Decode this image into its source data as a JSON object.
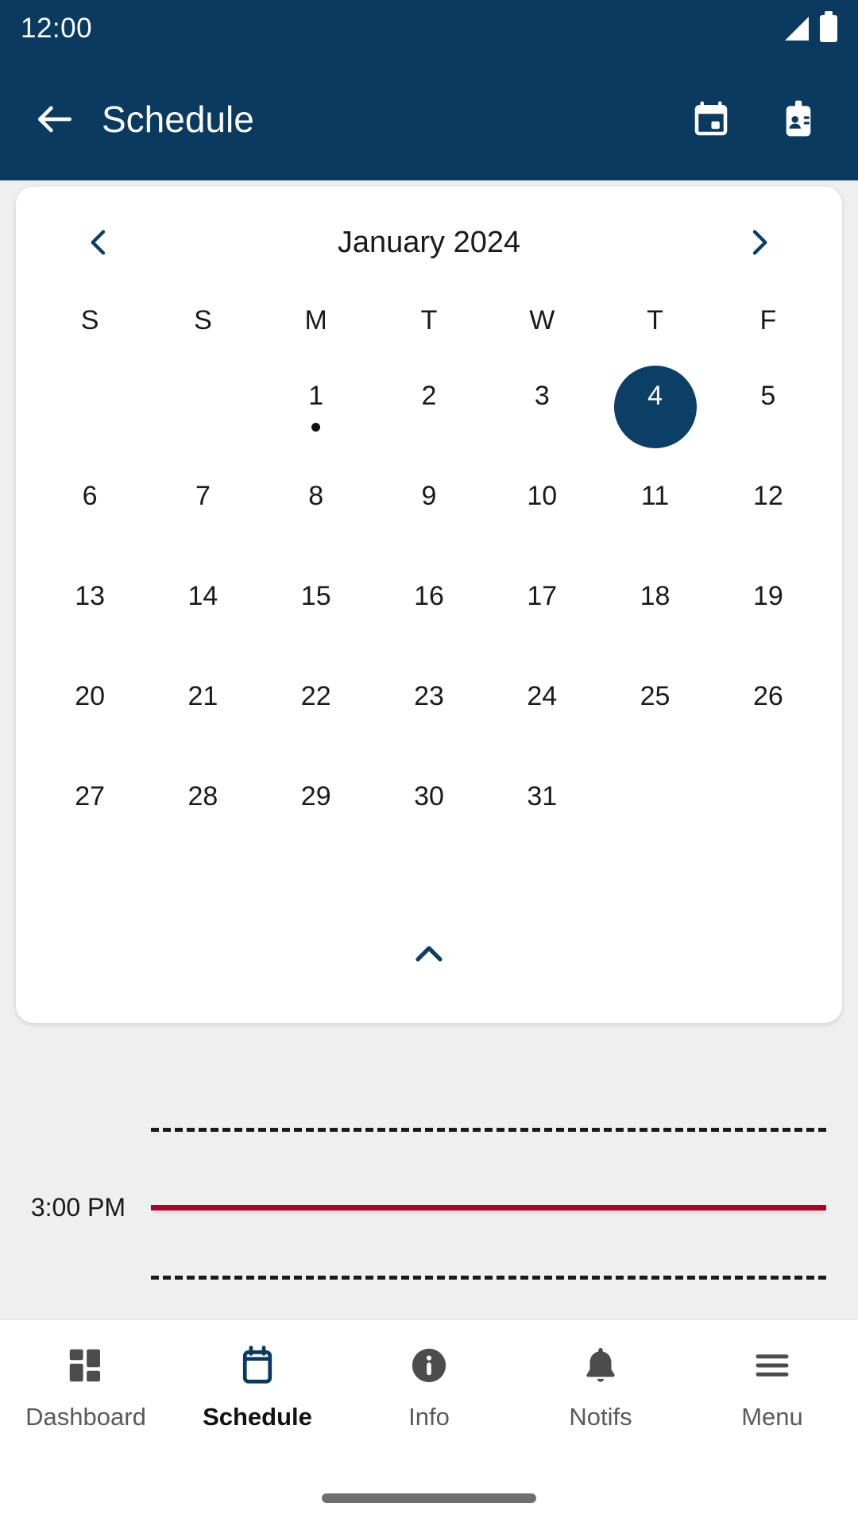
{
  "status_bar": {
    "time": "12:00",
    "signal_icon": "signal-triangle-icon",
    "battery_icon": "battery-full-icon"
  },
  "app_bar": {
    "back_icon": "arrow-left-icon",
    "title": "Schedule",
    "actions": [
      {
        "name": "calendar-today-icon",
        "label": "Calendar"
      },
      {
        "name": "id-badge-icon",
        "label": "Badge"
      }
    ]
  },
  "calendar": {
    "prev_icon": "chevron-left-icon",
    "next_icon": "chevron-right-icon",
    "month_title": "January 2024",
    "collapse_icon": "chevron-up-icon",
    "weekday_headers": [
      "S",
      "S",
      "M",
      "T",
      "W",
      "T",
      "F"
    ],
    "selected_day": 4,
    "event_days": [
      1
    ],
    "weeks": [
      [
        "",
        "",
        "1",
        "2",
        "3",
        "4",
        "5"
      ],
      [
        "6",
        "7",
        "8",
        "9",
        "10",
        "11",
        "12"
      ],
      [
        "13",
        "14",
        "15",
        "16",
        "17",
        "18",
        "19"
      ],
      [
        "20",
        "21",
        "22",
        "23",
        "24",
        "25",
        "26"
      ],
      [
        "27",
        "28",
        "29",
        "30",
        "31",
        "",
        ""
      ]
    ]
  },
  "timeline": {
    "current_time_label": "3:00 PM",
    "current_time_color": "#A8032B",
    "dashed_line_color": "#1A1A1A"
  },
  "bottom_nav": {
    "items": [
      {
        "label": "Dashboard",
        "icon": "dashboard-grid-icon",
        "active": false
      },
      {
        "label": "Schedule",
        "icon": "calendar-icon",
        "active": true
      },
      {
        "label": "Info",
        "icon": "info-circle-icon",
        "active": false
      },
      {
        "label": "Notifs",
        "icon": "bell-icon",
        "active": false
      },
      {
        "label": "Menu",
        "icon": "hamburger-menu-icon",
        "active": false
      }
    ]
  },
  "colors": {
    "brand_navy": "#0A3A60",
    "selected_navy": "#0C3F66",
    "accent_red": "#A8032B",
    "page_background": "#EFEFEF",
    "card_background": "#FFFFFF"
  },
  "system": {
    "gesture_bar": "home-gesture-bar"
  }
}
